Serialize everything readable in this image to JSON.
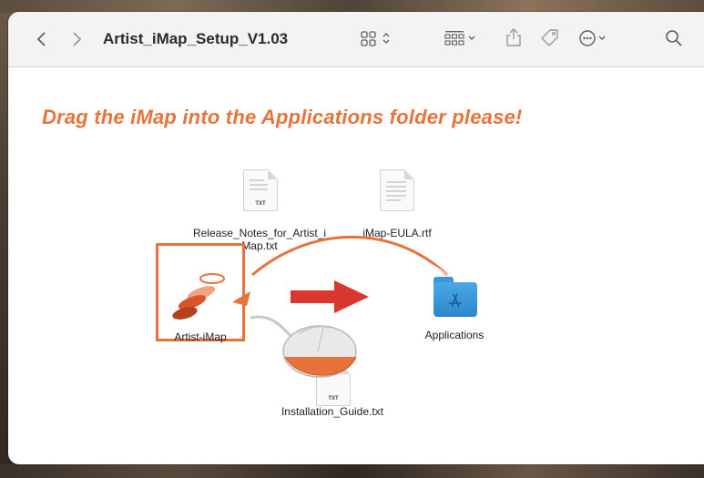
{
  "window": {
    "title": "Artist_iMap_Setup_V1.03"
  },
  "toolbar": {
    "back_icon": "chevron-left-icon",
    "forward_icon": "chevron-right-icon",
    "icon_view": "icon-view-icon",
    "group_by": "group-by-icon",
    "share": "share-icon",
    "tag": "tag-icon",
    "more": "ellipsis-circle-icon",
    "search": "search-icon"
  },
  "content": {
    "headline": "Drag the iMap into the Applications folder please!",
    "accent_color": "#e8733a",
    "files": [
      {
        "label": "Release_Notes_for_Artist_i Map.txt",
        "badge": "TXT",
        "label_line1": "Release_Notes_for_Artist_i",
        "label_line2": "Map.txt"
      },
      {
        "label": "iMap-EULA.rtf"
      },
      {
        "label": "Artist-iMap"
      },
      {
        "label": "Applications"
      },
      {
        "label": "Installation_Guide.txt",
        "badge": "TXT"
      }
    ]
  }
}
